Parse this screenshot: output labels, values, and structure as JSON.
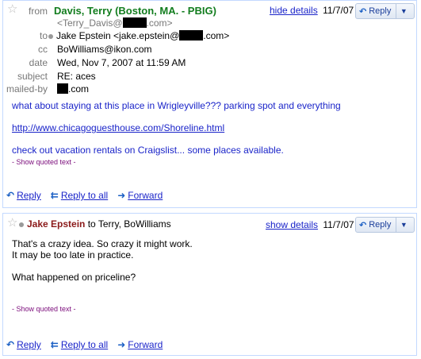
{
  "message1": {
    "header": {
      "from_label": "from",
      "sender_name": "Davis, Terry (Boston, MA. - PBIG)",
      "sender_email_prefix": "<Terry_Davis@",
      "sender_email_suffix": ".com>",
      "to_label": "to",
      "to_prefix": "Jake Epstein <jake.epstein@",
      "to_suffix": ".com>",
      "cc_label": "cc",
      "cc_value": "BoWilliams@ikon.com",
      "date_label": "date",
      "date_value": "Wed, Nov 7, 2007 at 11:59 AM",
      "subject_label": "subject",
      "subject_value": "RE: aces",
      "mailedby_label": "mailed-by",
      "mailedby_suffix": ".com",
      "hide_details": "hide details",
      "date_short": "11/7/07",
      "reply_label": "Reply"
    },
    "body": {
      "line1": "what about staying at this place in Wrigleyville???  parking spot and everything",
      "link": "http://www.chicagoguesthouse.com/Shoreline.html",
      "line2": "check out vacation rentals on Craigslist... some places available.",
      "quoted": "- Show quoted text -"
    },
    "footer": {
      "reply": "Reply",
      "reply_all": "Reply to all",
      "forward": "Forward"
    }
  },
  "message2": {
    "header": {
      "sender_name": "Jake Epstein",
      "recipients": "to Terry, BoWilliams",
      "show_details": "show details",
      "date_short": "11/7/07",
      "reply_label": "Reply"
    },
    "body": {
      "line1": "That's a crazy idea.  So crazy it might work.",
      "line2": "It may be too late in practice.",
      "line3": "What happened on priceline?",
      "quoted": "- Show quoted text -"
    },
    "footer": {
      "reply": "Reply",
      "reply_all": "Reply to all",
      "forward": "Forward"
    }
  },
  "colors": {
    "sender_green": "#127d1e",
    "sender_red": "#8b1a1a",
    "link_blue": "#1a24c9",
    "quoted_purple": "#7a0a7a"
  }
}
